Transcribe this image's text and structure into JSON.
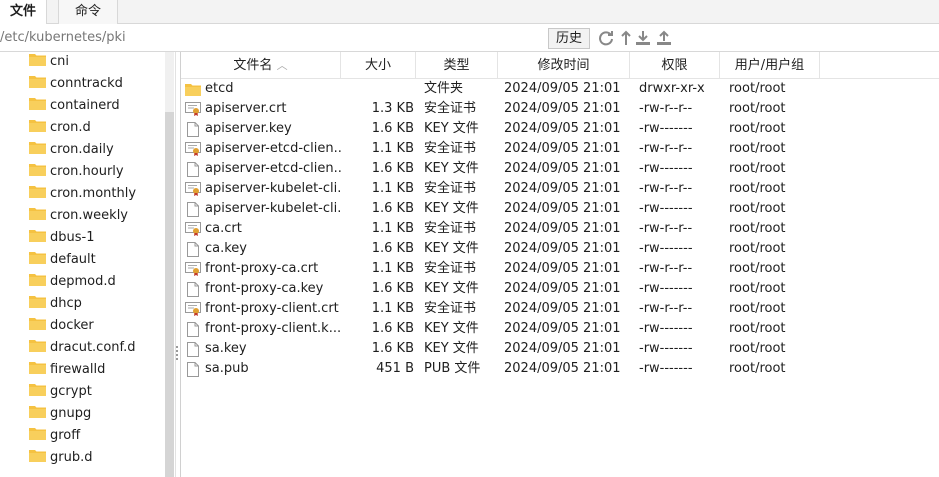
{
  "tabs": [
    {
      "label": "文件",
      "active": true
    },
    {
      "label": "命令",
      "active": false
    }
  ],
  "path": {
    "value": "/etc/kubernetes/pki",
    "history_label": "历史"
  },
  "toolbar_icons": [
    "refresh-icon",
    "up-folder-icon",
    "download-icon",
    "upload-icon"
  ],
  "tree": {
    "items": [
      "cni",
      "conntrackd",
      "containerd",
      "cron.d",
      "cron.daily",
      "cron.hourly",
      "cron.monthly",
      "cron.weekly",
      "dbus-1",
      "default",
      "depmod.d",
      "dhcp",
      "docker",
      "dracut.conf.d",
      "firewalld",
      "gcrypt",
      "gnupg",
      "groff",
      "grub.d"
    ]
  },
  "columns": {
    "name": "文件名",
    "size": "大小",
    "type": "类型",
    "time": "修改时间",
    "perm": "权限",
    "owner": "用户/用户组"
  },
  "files": [
    {
      "icon": "folder",
      "name": "etcd",
      "size": "",
      "type": "文件夹",
      "time": "2024/09/05 21:01",
      "perm": "drwxr-xr-x",
      "owner": "root/root"
    },
    {
      "icon": "cert",
      "name": "apiserver.crt",
      "size": "1.3 KB",
      "type": "安全证书",
      "time": "2024/09/05 21:01",
      "perm": "-rw-r--r--",
      "owner": "root/root"
    },
    {
      "icon": "file",
      "name": "apiserver.key",
      "size": "1.6 KB",
      "type": "KEY 文件",
      "time": "2024/09/05 21:01",
      "perm": "-rw-------",
      "owner": "root/root"
    },
    {
      "icon": "cert",
      "name": "apiserver-etcd-clien...",
      "size": "1.1 KB",
      "type": "安全证书",
      "time": "2024/09/05 21:01",
      "perm": "-rw-r--r--",
      "owner": "root/root"
    },
    {
      "icon": "file",
      "name": "apiserver-etcd-clien...",
      "size": "1.6 KB",
      "type": "KEY 文件",
      "time": "2024/09/05 21:01",
      "perm": "-rw-------",
      "owner": "root/root"
    },
    {
      "icon": "cert",
      "name": "apiserver-kubelet-cli...",
      "size": "1.1 KB",
      "type": "安全证书",
      "time": "2024/09/05 21:01",
      "perm": "-rw-r--r--",
      "owner": "root/root"
    },
    {
      "icon": "file",
      "name": "apiserver-kubelet-cli...",
      "size": "1.6 KB",
      "type": "KEY 文件",
      "time": "2024/09/05 21:01",
      "perm": "-rw-------",
      "owner": "root/root"
    },
    {
      "icon": "cert",
      "name": "ca.crt",
      "size": "1.1 KB",
      "type": "安全证书",
      "time": "2024/09/05 21:01",
      "perm": "-rw-r--r--",
      "owner": "root/root"
    },
    {
      "icon": "file",
      "name": "ca.key",
      "size": "1.6 KB",
      "type": "KEY 文件",
      "time": "2024/09/05 21:01",
      "perm": "-rw-------",
      "owner": "root/root"
    },
    {
      "icon": "cert",
      "name": "front-proxy-ca.crt",
      "size": "1.1 KB",
      "type": "安全证书",
      "time": "2024/09/05 21:01",
      "perm": "-rw-r--r--",
      "owner": "root/root"
    },
    {
      "icon": "file",
      "name": "front-proxy-ca.key",
      "size": "1.6 KB",
      "type": "KEY 文件",
      "time": "2024/09/05 21:01",
      "perm": "-rw-------",
      "owner": "root/root"
    },
    {
      "icon": "cert",
      "name": "front-proxy-client.crt",
      "size": "1.1 KB",
      "type": "安全证书",
      "time": "2024/09/05 21:01",
      "perm": "-rw-r--r--",
      "owner": "root/root"
    },
    {
      "icon": "file",
      "name": "front-proxy-client.k...",
      "size": "1.6 KB",
      "type": "KEY 文件",
      "time": "2024/09/05 21:01",
      "perm": "-rw-------",
      "owner": "root/root"
    },
    {
      "icon": "file",
      "name": "sa.key",
      "size": "1.6 KB",
      "type": "KEY 文件",
      "time": "2024/09/05 21:01",
      "perm": "-rw-------",
      "owner": "root/root"
    },
    {
      "icon": "file",
      "name": "sa.pub",
      "size": "451 B",
      "type": "PUB 文件",
      "time": "2024/09/05 21:01",
      "perm": "-rw-------",
      "owner": "root/root"
    }
  ],
  "colors": {
    "folder": "#f5c242",
    "accent": "#3c8fd8",
    "icon_gray": "#888888"
  }
}
